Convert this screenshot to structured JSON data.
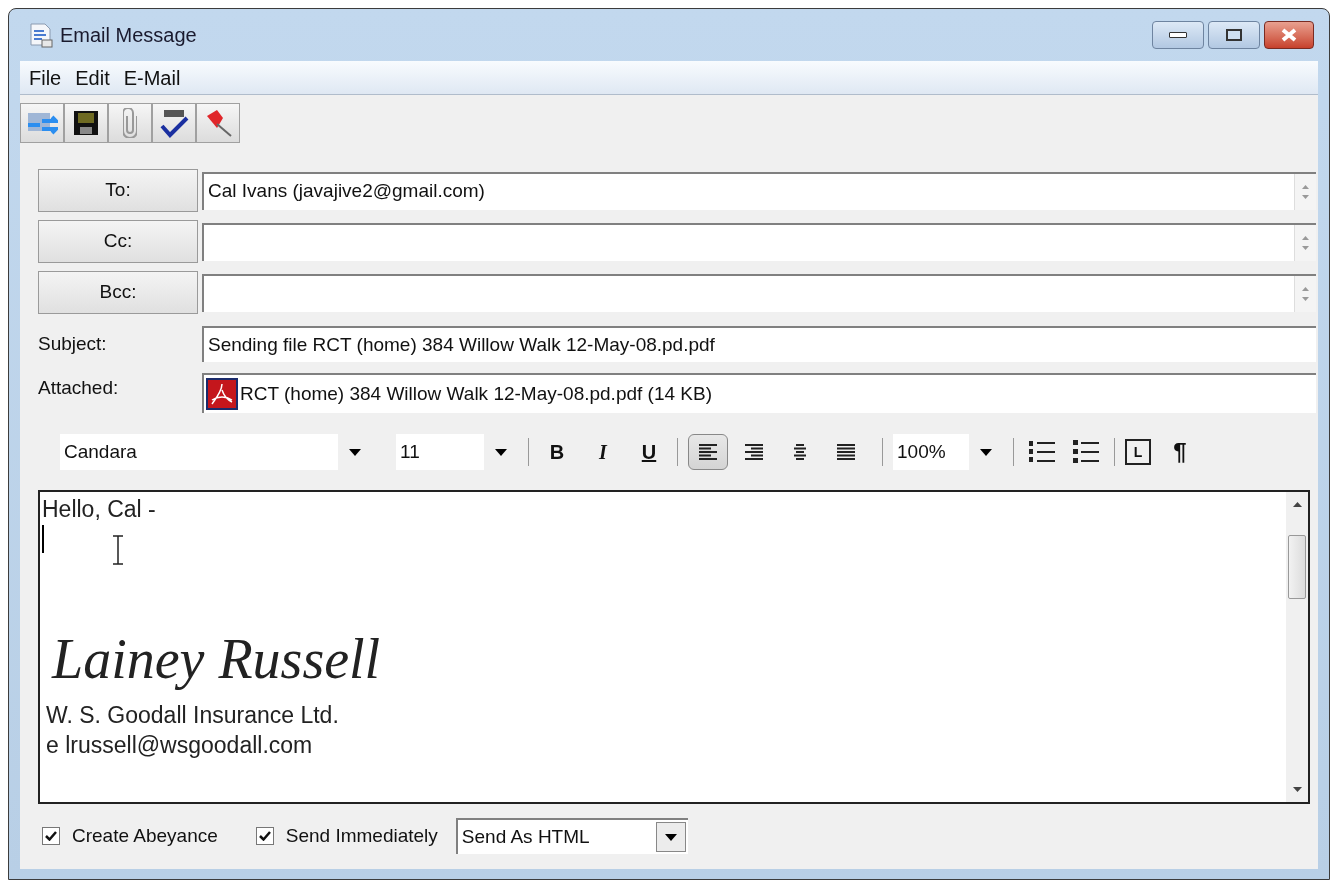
{
  "window": {
    "title": "Email Message"
  },
  "menu": [
    "File",
    "Edit",
    "E-Mail"
  ],
  "recipients": [
    {
      "label": "To:",
      "value": "Cal Ivans (javajive2@gmail.com)"
    },
    {
      "label": "Cc:"
    },
    {
      "label": "Bcc:"
    }
  ],
  "subject": {
    "label": "Subject:",
    "value": "Sending file RCT (home) 384 Willow Walk 12-May-08.pd.pdf"
  },
  "attachment": {
    "label": "Attached:",
    "value": "RCT (home) 384 Willow Walk 12-May-08.pd.pdf (14 KB)"
  },
  "format_bar": {
    "font": "Candara",
    "size": "11",
    "bold": "B",
    "italic": "I",
    "underline": "U",
    "zoom": "100%",
    "table": "L",
    "pilcrow": "¶",
    "alignments": [
      {
        "kind": "left",
        "selected": true
      },
      {
        "kind": "right",
        "selected": false
      },
      {
        "kind": "center",
        "selected": false
      },
      {
        "kind": "justify",
        "selected": false
      }
    ]
  },
  "body": {
    "greeting": "Hello, Cal -",
    "signature": "Lainey Russell",
    "lines": [
      "W. S. Goodall Insurance Ltd.",
      "e lrussell@wsgoodall.com"
    ]
  },
  "options": [
    {
      "label": "Create Abeyance",
      "checked": true
    },
    {
      "label": "Send Immediately",
      "checked": true
    }
  ],
  "send_format": "Send As HTML"
}
